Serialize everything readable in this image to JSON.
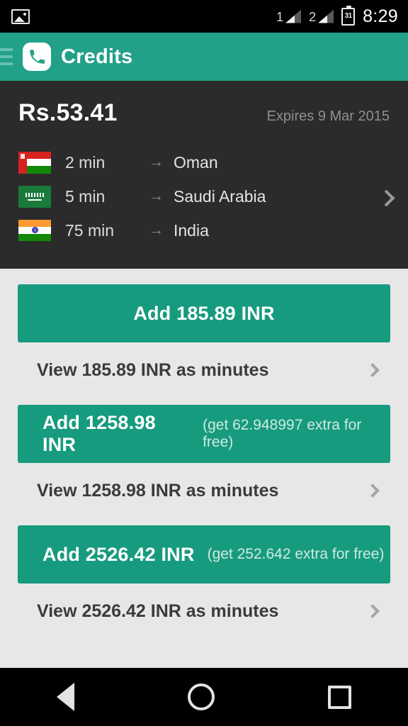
{
  "statusbar": {
    "photo_icon": "photo-icon",
    "sim1_label": "1",
    "sim2_label": "2",
    "battery_label": "31",
    "time": "8:29"
  },
  "appbar": {
    "menu_icon": "hamburger-menu-icon",
    "logo_icon": "phone-icon",
    "title": "Credits",
    "background_color": "#22a188"
  },
  "balance_card": {
    "amount": "Rs.53.41",
    "expires": "Expires 9 Mar 2015",
    "background_color": "#2b2b2b",
    "rows": [
      {
        "flag": "oman-flag",
        "minutes": "2 min",
        "arrow": "→",
        "country": "Oman"
      },
      {
        "flag": "saudi-arabia-flag",
        "minutes": "5 min",
        "arrow": "→",
        "country": "Saudi Arabia"
      },
      {
        "flag": "india-flag",
        "minutes": "75 min",
        "arrow": "→",
        "country": "India"
      }
    ]
  },
  "offers": [
    {
      "add_label": "Add 185.89 INR",
      "bonus": "",
      "view_label": "View 185.89 INR as minutes"
    },
    {
      "add_label": "Add 1258.98 INR",
      "bonus": "(get 62.948997 extra for free)",
      "view_label": "View 1258.98 INR as minutes"
    },
    {
      "add_label": "Add 2526.42 INR",
      "bonus": "(get 252.642 extra for free)",
      "view_label": "View 2526.42 INR as minutes"
    }
  ],
  "navbar": {
    "back_icon": "back-triangle-icon",
    "home_icon": "home-circle-icon",
    "recents_icon": "recents-square-icon"
  },
  "colors": {
    "accent": "#22a188",
    "button": "#179b7e",
    "page_background": "#e7e7e7"
  }
}
